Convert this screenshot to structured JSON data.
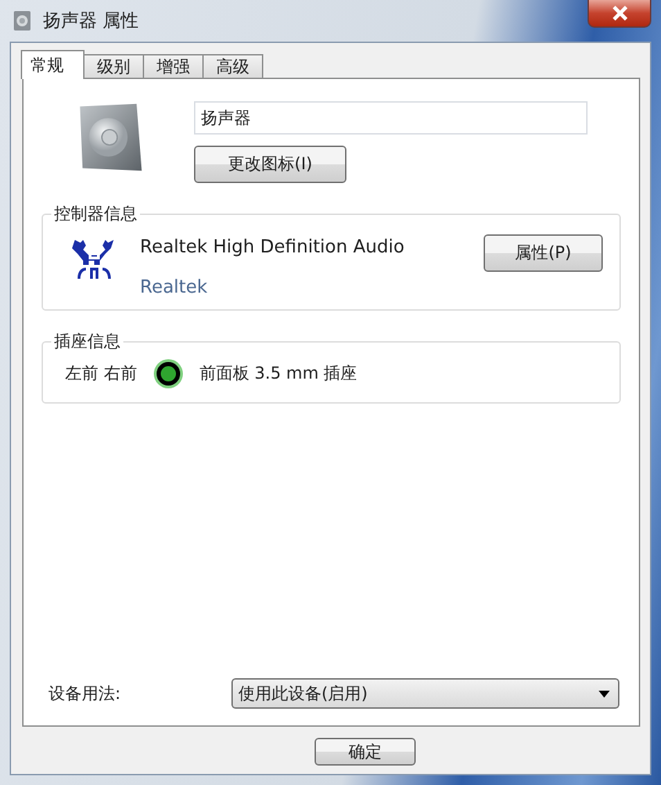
{
  "window": {
    "title": "扬声器 属性"
  },
  "tabs": [
    {
      "label": "常规",
      "selected": true
    },
    {
      "label": "级别",
      "selected": false
    },
    {
      "label": "增强",
      "selected": false
    },
    {
      "label": "高级",
      "selected": false
    }
  ],
  "device": {
    "name": "扬声器",
    "change_icon_button": "更改图标(I)"
  },
  "controller": {
    "legend": "控制器信息",
    "name": "Realtek High Definition Audio",
    "vendor": "Realtek",
    "properties_button": "属性(P)"
  },
  "jack": {
    "legend": "插座信息",
    "channels": "左前 右前",
    "color": "#2fa52f",
    "description": "前面板 3.5 mm 插座"
  },
  "usage": {
    "label": "设备用法:",
    "value": "使用此设备(启用)"
  },
  "buttons": [
    "确定"
  ]
}
